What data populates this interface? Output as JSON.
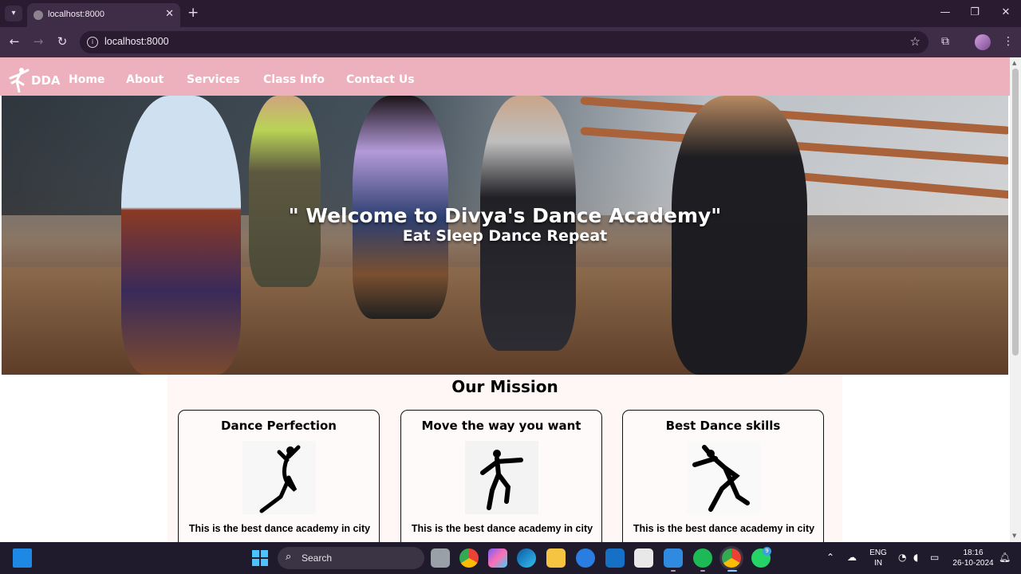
{
  "browser": {
    "tab_title": "localhost:8000",
    "url": "localhost:8000",
    "new_tab_symbol": "+",
    "close_symbol": "✕",
    "icons": [
      "tab-search-icon",
      "close-icon",
      "new-tab-icon",
      "minimize-icon",
      "maximize-icon",
      "window-close-icon",
      "back-icon",
      "forward-icon",
      "reload-icon",
      "site-info-icon",
      "bookmark-star-icon",
      "extensions-icon",
      "profile-avatar",
      "menu-icon"
    ]
  },
  "site": {
    "logo": "DDA",
    "nav": [
      "Home",
      "About",
      "Services",
      "Class Info",
      "Contact Us"
    ],
    "hero": {
      "title": "\" Welcome to Divya's Dance Academy\"",
      "subtitle": "Eat Sleep Dance Repeat"
    },
    "mission": {
      "title": "Our Mission",
      "cards": [
        {
          "title": "Dance Perfection",
          "text": "This is the best dance academy in city"
        },
        {
          "title": "Move the way you want",
          "text": "This is the best dance academy in city"
        },
        {
          "title": "Best Dance skills",
          "text": "This is the best dance academy in city"
        }
      ]
    },
    "colors": {
      "navbar": "#ecb1bc",
      "mission_bg": "#fff7f6"
    }
  },
  "taskbar": {
    "search_label": "Search",
    "language": "ENG",
    "region": "IN",
    "time": "18:16",
    "date": "26-10-2024",
    "whatsapp_badge": "9"
  }
}
